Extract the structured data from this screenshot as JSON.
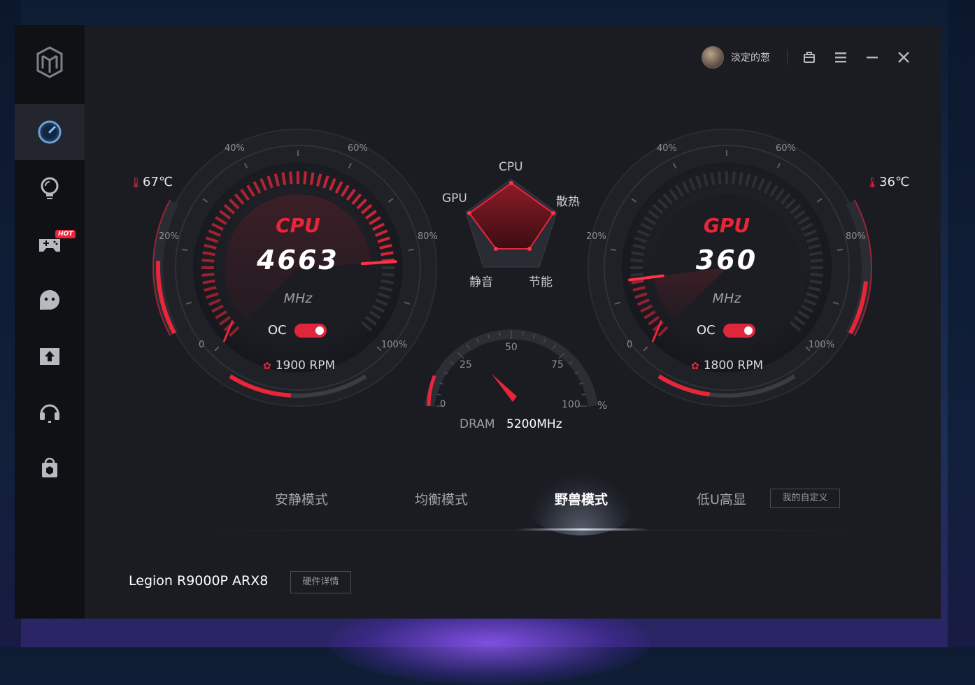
{
  "user": {
    "name": "淡定的葱"
  },
  "cpu_gauge": {
    "title": "CPU",
    "value": "4663",
    "unit": "MHz",
    "usage_level": 0.82,
    "temp": "67℃",
    "temp_level": 0.55,
    "fan": "1900 RPM",
    "fan_level": 0.45,
    "oc_label": "OC",
    "oc_on": true,
    "ticks": {
      "t0": "0",
      "t20": "20%",
      "t40": "40%",
      "t60": "60%",
      "t80": "80%",
      "t100": "100%"
    }
  },
  "gpu_gauge": {
    "title": "GPU",
    "value": "360",
    "unit": "MHz",
    "usage_level": 0.14,
    "temp": "36℃",
    "temp_level": 0.4,
    "fan": "1800 RPM",
    "fan_level": 0.38,
    "oc_label": "OC",
    "oc_on": true,
    "ticks": {
      "t0": "0",
      "t20": "20%",
      "t40": "40%",
      "t60": "60%",
      "t80": "80%",
      "t100": "100%"
    }
  },
  "radar": {
    "labels": {
      "top": "CPU",
      "right": "散热",
      "bottom_right": "节能",
      "bottom_left": "静音",
      "left": "GPU"
    }
  },
  "dram": {
    "label": "DRAM",
    "speed": "5200MHz",
    "unit": "%",
    "usage_level": 0.12,
    "ticks": {
      "t0": "0",
      "t25": "25",
      "t50": "50",
      "t75": "75",
      "t100": "100"
    }
  },
  "modes": {
    "items": [
      "安静模式",
      "均衡模式",
      "野兽模式",
      "低U高显"
    ],
    "active": "野兽模式",
    "custom_button": "我的自定义"
  },
  "device": {
    "model": "Legion R9000P ARX8",
    "details_button": "硬件详情"
  },
  "colors": {
    "accent": "#e8263a",
    "background": "#1a1c22",
    "sidebar": "#101115"
  }
}
